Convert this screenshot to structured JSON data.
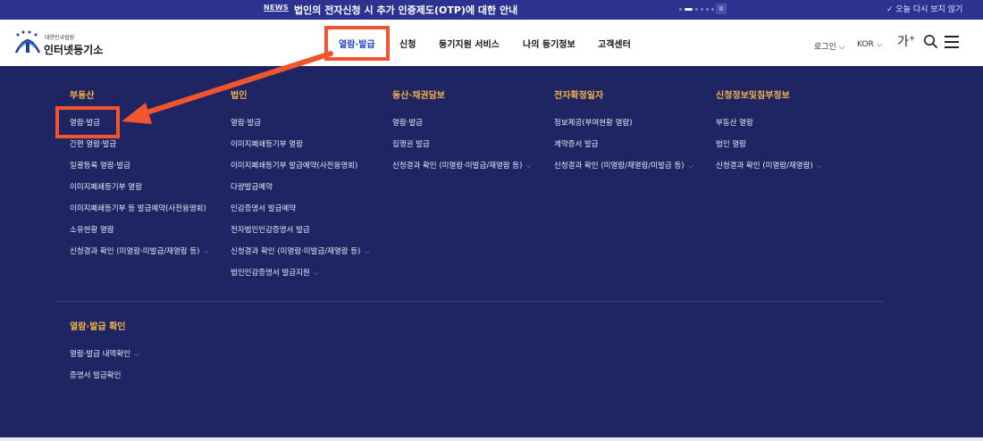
{
  "newsbar": {
    "tag": "NEWS",
    "text": "법인의 전자신청 시 추가 인증제도(OTP)에 대한 안내",
    "pause_label": "II",
    "close_label": "✓ 오늘 다시 보지 않기"
  },
  "header": {
    "logo_small": "대한민국법원",
    "logo_main": "인터넷등기소",
    "nav": [
      "열람·발급",
      "신청",
      "등기지원 서비스",
      "나의 등기정보",
      "고객센터"
    ],
    "login": "로그인",
    "language": "KOR",
    "font_size_label": "가",
    "font_size_plus": "+"
  },
  "menu": {
    "columns": [
      {
        "title": "부동산",
        "items": [
          "열람·발급",
          "간편 열람·발급",
          "일괄등록 열람·발급",
          "이미지폐쇄등기부 열람",
          "이미지폐쇄등기부 등 발급예약(사전융영회)",
          "소유현황 열람",
          "신청결과 확인 (미열람·미발급/재열람 등)"
        ]
      },
      {
        "title": "법인",
        "items": [
          "열람·발급",
          "이미지폐쇄등기부 열람",
          "이미지폐쇄등기부 발급예약(사전융영회)",
          "다량발급예약",
          "인감증명서 발급예약",
          "전자법인인감증명서 발급",
          "신청결과 확인 (미열람·미발급/재열람 등)",
          "법인인감증명서 발급지원"
        ]
      },
      {
        "title": "동산·채권담보",
        "items": [
          "열람·발급",
          "집행권 발급",
          "신청결과 확인 (미열람·미발급/재열람 등)"
        ]
      },
      {
        "title": "전자확정일자",
        "items": [
          "정보제공(부여현황 열람)",
          "계약증서 발급",
          "신청결과 확인 (미열람/재열람/미발급 등)"
        ]
      },
      {
        "title": "신청정보및침부정보",
        "items": [
          "부동산 열람",
          "법인 열람",
          "신청결과 확인 (미열람/재열람)"
        ]
      }
    ],
    "confirm": {
      "title": "열람·발급 확인",
      "items": [
        "열람·발급 내역확인",
        "증명서 발급확인"
      ]
    }
  },
  "colors": {
    "menu_bg": "#1f2463",
    "newsbar_bg": "#2b3290",
    "accent_orange": "#f3b24a",
    "active_nav": "#2646c8",
    "annotation": "#f0552e"
  }
}
